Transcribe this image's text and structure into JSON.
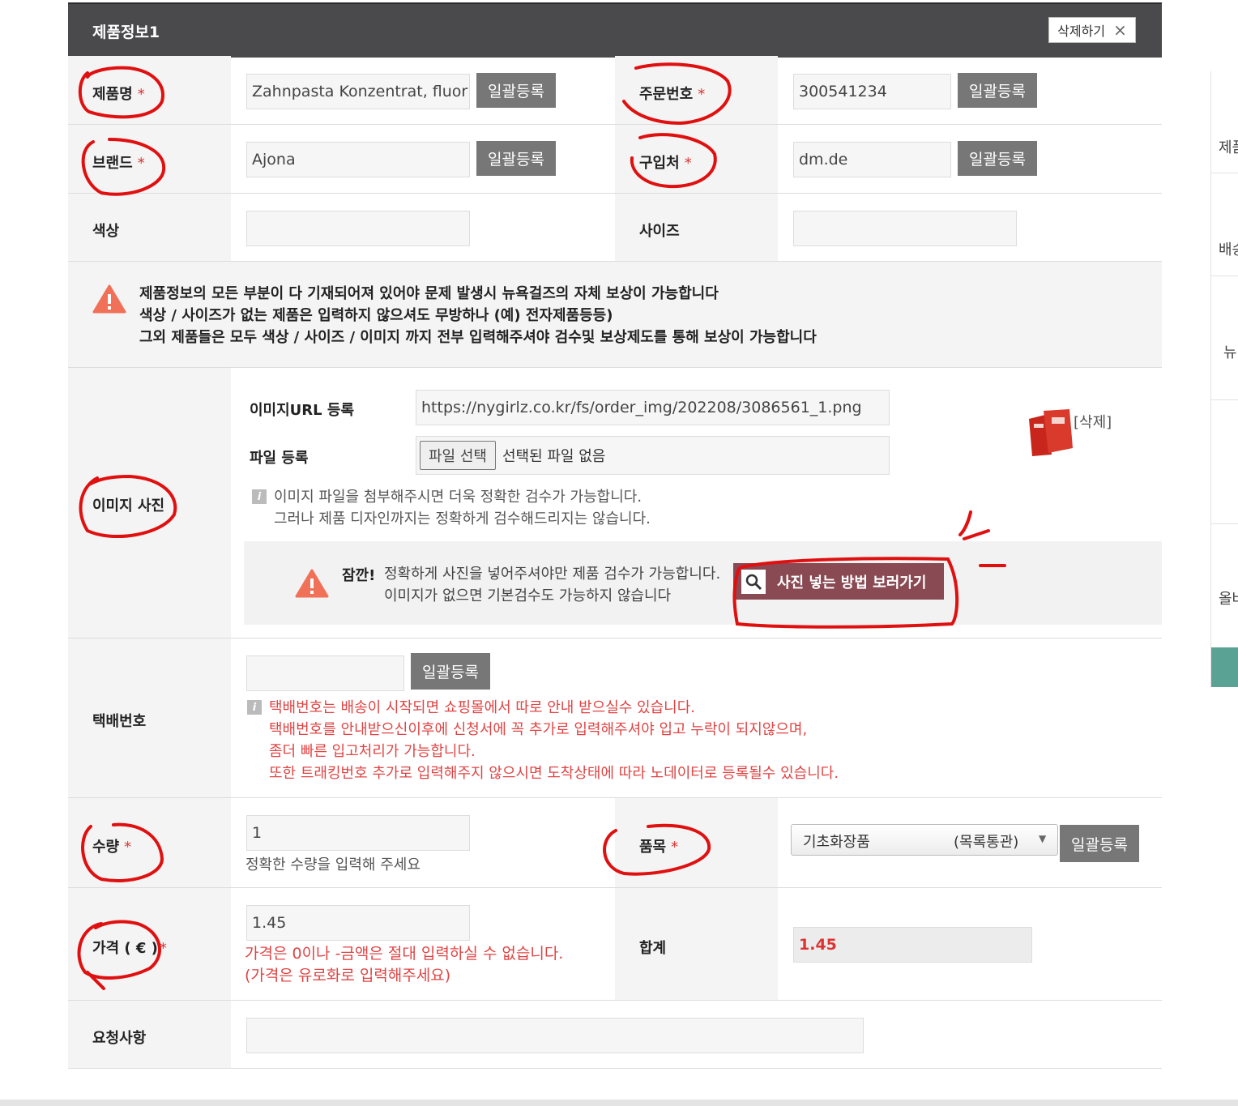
{
  "header": {
    "title": "제품정보1",
    "delete_label": "삭제하기",
    "delete_icon": "×"
  },
  "product_name": {
    "label": "제품명",
    "star": "*",
    "value": "Zahnpasta Konzentrat, fluoric",
    "button": "일괄등록"
  },
  "order_number": {
    "label": "주문번호",
    "star": "*",
    "value": "300541234",
    "button": "일괄등록"
  },
  "brand": {
    "label": "브랜드",
    "star": "*",
    "value": "Ajona",
    "button": "일괄등록"
  },
  "store": {
    "label": "구입처",
    "star": "*",
    "value": "dm.de",
    "button": "일괄등록"
  },
  "color": {
    "label": "색상",
    "value": ""
  },
  "size": {
    "label": "사이즈",
    "value": ""
  },
  "notice": {
    "lines": [
      "제품정보의 모든 부분이 다 기재되어져 있어야 문제 발생시 뉴욕걸즈의 자체 보상이 가능합니다",
      "색상 / 사이즈가 없는 제품은 입력하지 않으셔도 무방하나 (예) 전자제품등등)",
      "그외 제품들은 모두 색상 / 사이즈 / 이미지 까지 전부 입력해주셔야 검수및 보상제도를 통해 보상이 가능합니다"
    ]
  },
  "image": {
    "label": "이미지 사진",
    "url_label": "이미지URL 등록",
    "url_value": "https://nygirlz.co.kr/fs/order_img/202208/3086561_1.png",
    "file_label": "파일 등록",
    "file_button": "파일 선택",
    "file_status": "선택된 파일 없음",
    "delete_link": "[삭제]",
    "help_lines": [
      "이미지 파일을 첨부해주시면 더욱 정확한 검수가 가능합니다.",
      "그러나 제품 디자인까지는 정확하게 검수해드리지는 않습니다."
    ],
    "warning_title": "잠깐!",
    "warning_lines": [
      "정확하게 사진을 넣어주셔야만 제품 검수가 가능합니다.",
      "이미지가 없으면 기본검수도 가능하지 않습니다"
    ],
    "howto_button": "사진 넣는 방법 보러가기"
  },
  "tracking": {
    "label": "택배번호",
    "value": "",
    "button": "일괄등록",
    "notes": [
      "택배번호는 배송이 시작되면 쇼핑몰에서 따로 안내 받으실수 있습니다.",
      "택배번호를 안내받으신이후에 신청서에 꼭 추가로 입력해주셔야 입고 누락이 되지않으며,",
      "좀더 빠른 입고처리가 가능합니다.",
      "또한 트래킹번호 추가로 입력해주지 않으시면 도착상태에 따라 노데이터로 등록될수 있습니다."
    ]
  },
  "quantity": {
    "label": "수량",
    "star": "*",
    "value": "1",
    "hint": "정확한 수량을 입력해 주세요"
  },
  "category": {
    "label": "품목",
    "star": "*",
    "selected": "기초화장품",
    "selected_note": "(목록통관)",
    "button": "일괄등록"
  },
  "price": {
    "label": "가격 ( € )",
    "star": "*",
    "value": "1.45",
    "notes": [
      "가격은 0이나 -금액은 절대 입력하실 수 없습니다.",
      "(가격은 유로화로 입력해주세요)"
    ]
  },
  "total": {
    "label": "합계",
    "value": "1.45"
  },
  "request": {
    "label": "요청사항",
    "value": ""
  },
  "sidebar": {
    "items": [
      "제품",
      "배송",
      "뉴",
      "올바"
    ]
  },
  "colors": {
    "header_bg": "#4a4a4c",
    "button_bg": "#777777",
    "accent_red": "#e04444",
    "howto_bg": "#8a4a54",
    "sidebar_accent": "#5aa394"
  }
}
